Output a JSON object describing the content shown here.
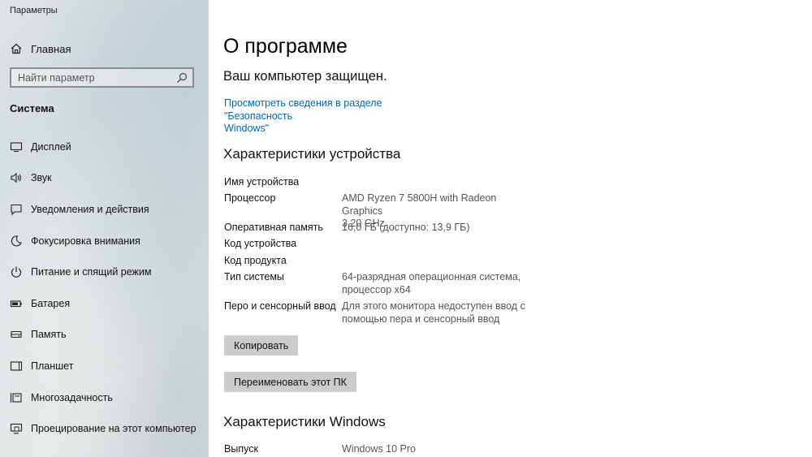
{
  "window": {
    "title": "Параметры"
  },
  "sidebar": {
    "home_label": "Главная",
    "search_placeholder": "Найти параметр",
    "section_label": "Система",
    "items": [
      {
        "label": "Дисплей",
        "icon": "display-icon"
      },
      {
        "label": "Звук",
        "icon": "sound-icon"
      },
      {
        "label": "Уведомления и действия",
        "icon": "notifications-icon"
      },
      {
        "label": "Фокусировка внимания",
        "icon": "focus-assist-icon"
      },
      {
        "label": "Питание и спящий режим",
        "icon": "power-icon"
      },
      {
        "label": "Батарея",
        "icon": "battery-icon"
      },
      {
        "label": "Память",
        "icon": "storage-icon"
      },
      {
        "label": "Планшет",
        "icon": "tablet-icon"
      },
      {
        "label": "Многозадачность",
        "icon": "multitasking-icon"
      },
      {
        "label": "Проецирование на этот компьютер",
        "icon": "projecting-icon"
      }
    ]
  },
  "main": {
    "title": "О программе",
    "protected_text": "Ваш компьютер защищен.",
    "security_link_line1": "Просмотреть сведения в разделе \"Безопасность",
    "security_link_line2": "Windows\"",
    "device_specs": {
      "heading": "Характеристики устройства",
      "device_name_label": "Имя устройства",
      "processor_label": "Процессор",
      "processor_value_line1": "AMD Ryzen 7 5800H with Radeon Graphics",
      "processor_value_line2": "3.20 GHz",
      "ram_label": "Оперативная память",
      "ram_value": "16,0 ГБ (доступно: 13,9 ГБ)",
      "device_id_label": "Код устройства",
      "product_id_label": "Код продукта",
      "system_type_label": "Тип системы",
      "system_type_value_line1": "64-разрядная операционная система,",
      "system_type_value_line2": "процессор x64",
      "pen_touch_label": "Перо и сенсорный ввод",
      "pen_touch_value_line1": "Для этого монитора недоступен ввод с",
      "pen_touch_value_line2": "помощью пера и сенсорный ввод"
    },
    "copy_button": "Копировать",
    "rename_button": "Переименовать этот ПК",
    "windows_specs": {
      "heading": "Характеристики Windows",
      "edition_label": "Выпуск",
      "edition_value": "Windows 10 Pro"
    }
  },
  "colors": {
    "link": "#0067b8",
    "button_bg": "#cccccc"
  }
}
